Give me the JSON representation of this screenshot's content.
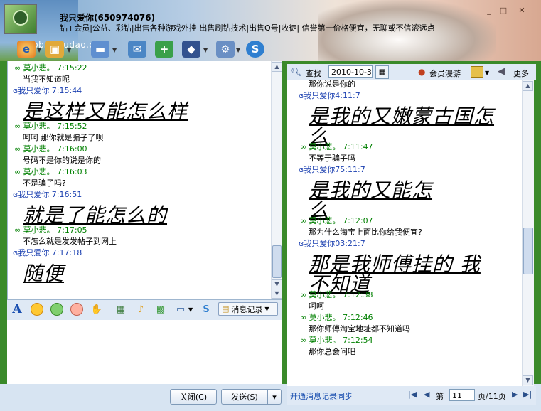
{
  "window": {
    "title": "我只爱你(650974076)",
    "subtitle": "钻+会员|公益、彩钻|出售各种游戏外挂|出售刷钻技术|出售Q号|收徒| 信誉第一价格便宜，无聊或不信滚远点",
    "watermark": "bbs.houdao.com",
    "min_label": "_",
    "max_label": "□",
    "close_label": "✕"
  },
  "toolbar": {
    "icons": [
      "browser-icon",
      "folder-icon",
      "mail-icon",
      "add-contact-icon",
      "police-icon",
      "settings-icon",
      "qq-icon"
    ]
  },
  "left_chat": [
    {
      "kind": "hdr_green",
      "text": "∞   莫小悲。  7:15:22"
    },
    {
      "kind": "msg",
      "text": "当我不知道呢"
    },
    {
      "kind": "hdr_blue",
      "text": "ɞ我只爱你  7:15:44"
    },
    {
      "kind": "big",
      "text": "是这样又能怎么样"
    },
    {
      "kind": "hdr_green",
      "text": "∞   莫小悲。  7:15:52"
    },
    {
      "kind": "msg",
      "text": "呵呵  那你就是骗子了呗"
    },
    {
      "kind": "hdr_green",
      "text": "∞   莫小悲。  7:16:00"
    },
    {
      "kind": "msg",
      "text": "号码不是你的说是你的"
    },
    {
      "kind": "hdr_green",
      "text": "∞   莫小悲。  7:16:03"
    },
    {
      "kind": "msg",
      "text": "不是骗子吗?"
    },
    {
      "kind": "hdr_blue",
      "text": "ɞ我只爱你  7:16:51"
    },
    {
      "kind": "big",
      "text": "就是了能怎么的"
    },
    {
      "kind": "hdr_green",
      "text": "∞   莫小悲。  7:17:05"
    },
    {
      "kind": "msg",
      "text": "不怎么就是发发帖子到网上"
    },
    {
      "kind": "hdr_blue",
      "text": "ɞ我只爱你  7:17:18"
    },
    {
      "kind": "big",
      "text": "随便"
    }
  ],
  "input_toolbar": {
    "font_label": "A",
    "message_record": "消息记录"
  },
  "buttons": {
    "close": "关闭(C)",
    "send": "发送(S)",
    "send_dropdown": "▾"
  },
  "history": {
    "find_label": "查找",
    "date": "2010-10-3",
    "roaming": "会员漫游",
    "more": "更多",
    "sync": "开通消息记录同步",
    "page_prefix": "第",
    "page": "11",
    "page_suffix": "页/11页",
    "messages": [
      {
        "kind": "msg",
        "text": "那你说是你的"
      },
      {
        "kind": "hdr_blue",
        "text": "ɞ我只爱你4:11:7"
      },
      {
        "kind": "big",
        "text": "是我的又嫩蒙古国怎"
      },
      {
        "kind": "big",
        "text": "么"
      },
      {
        "kind": "hdr_green",
        "text": "∞   莫小悲。  7:11:47"
      },
      {
        "kind": "msg",
        "text": "不等于骗子吗"
      },
      {
        "kind": "hdr_blue",
        "text": "ɞ我只爱你75:11:7"
      },
      {
        "kind": "big",
        "text": "是我的又能怎"
      },
      {
        "kind": "big",
        "text": "么"
      },
      {
        "kind": "hdr_green",
        "text": "∞   莫小悲。  7:12:07"
      },
      {
        "kind": "msg",
        "text": "那为什么淘宝上面比你给我便宜?"
      },
      {
        "kind": "hdr_blue",
        "text": "ɞ我只爱你03:21:7"
      },
      {
        "kind": "big",
        "text": "那是我师傅挂的  我"
      },
      {
        "kind": "big",
        "text": "不知道"
      },
      {
        "kind": "hdr_green",
        "text": "∞   莫小悲。  7:12:38"
      },
      {
        "kind": "msg",
        "text": "呵呵"
      },
      {
        "kind": "hdr_green",
        "text": "∞   莫小悲。  7:12:46"
      },
      {
        "kind": "msg",
        "text": "那你师傅淘宝地址都不知道吗"
      },
      {
        "kind": "hdr_green",
        "text": "∞   莫小悲。  7:12:54"
      },
      {
        "kind": "msg",
        "text": "那你总会问吧"
      }
    ]
  }
}
